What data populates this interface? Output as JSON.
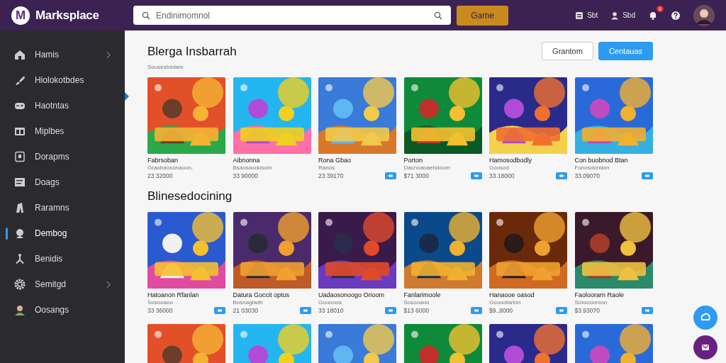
{
  "topbar": {
    "logo_letter": "M",
    "brand": "Marksplace",
    "search": {
      "placeholder": "Endinimomnol"
    },
    "search_button": "Game",
    "links": [
      {
        "label": "Sbt",
        "kind": "list"
      },
      {
        "label": "Sbd",
        "kind": "user"
      }
    ],
    "notifications": {
      "badge": "6"
    }
  },
  "sidebar": {
    "items": [
      {
        "label": "Hamis",
        "kind": "home",
        "expandable": true,
        "selected": false
      },
      {
        "label": "Hiolokotbdes",
        "kind": "brush",
        "expandable": false,
        "selected": false
      },
      {
        "label": "Haotntas",
        "kind": "gamepad",
        "expandable": false,
        "selected": false
      },
      {
        "label": "Miplbes",
        "kind": "card",
        "expandable": false,
        "selected": false
      },
      {
        "label": "Dorapms",
        "kind": "doc",
        "expandable": false,
        "selected": false
      },
      {
        "label": "Doags",
        "kind": "list",
        "expandable": false,
        "selected": false
      },
      {
        "label": "Raramns",
        "kind": "figure",
        "expandable": false,
        "selected": false
      },
      {
        "label": "Dembog",
        "kind": "bust",
        "expandable": false,
        "selected": true
      },
      {
        "label": "Benidis",
        "kind": "person",
        "expandable": false,
        "selected": false
      },
      {
        "label": "Semitgd",
        "kind": "gear",
        "expandable": true,
        "selected": false
      },
      {
        "label": "Oosangs",
        "kind": "avatar",
        "expandable": false,
        "selected": false
      }
    ]
  },
  "sections": [
    {
      "title": "Blerga Insbarrah",
      "subtitle": "Sousestoidam",
      "buttons": [
        {
          "label": "Grantom",
          "kind": "outline"
        },
        {
          "label": "Centauas",
          "kind": "primary"
        }
      ],
      "cards": [
        {
          "title": "Fabrsoban",
          "subtitle": "Graobaosonaoon,",
          "price": "23 32000",
          "cart_button": false
        },
        {
          "title": "Aibnonna",
          "subtitle": "Bsaosaodosom",
          "price": "33 90000",
          "cart_button": false
        },
        {
          "title": "Rona Gbao",
          "subtitle": "Ranos",
          "price": "23 39170",
          "cart_button": true
        },
        {
          "title": "Porton",
          "subtitle": "Dacnoaoaebdoom",
          "price": "$71 3000",
          "cart_button": true
        },
        {
          "title": "Hamosodbodly",
          "subtitle": "Goosod",
          "price": "33 18000",
          "cart_button": true
        },
        {
          "title": "Con buobnod Btan",
          "subtitle": "Fonosdondon",
          "price": "33.09070",
          "cart_button": true
        }
      ]
    },
    {
      "title": "Blinesedocining",
      "cards": [
        {
          "title": "Hatoanon Rfanlan",
          "subtitle": "Sosooaoo",
          "price": "33 36000",
          "cart_button": true
        },
        {
          "title": "Datura Goccit optus",
          "subtitle": "Bosnagladh",
          "price": "21 03030",
          "cart_button": true
        },
        {
          "title": "Uadaosonoogo Orioom",
          "subtitle": "Goooooa",
          "price": "33 18010",
          "cart_button": true
        },
        {
          "title": "Fanlarimoole",
          "subtitle": "Sosooaoo",
          "price": "$13 6000",
          "cart_button": true
        },
        {
          "title": "Hanaooe oasod",
          "subtitle": "Gooootarton",
          "price": "$9.,8000",
          "cart_button": true
        },
        {
          "title": "Faoloorarn Raole",
          "subtitle": "Sotooooroon",
          "price": "$3.93070",
          "cart_button": true
        }
      ]
    },
    {
      "cards": [
        {
          "kind": "picture"
        },
        {
          "kind": "picture"
        },
        {
          "kind": "picture"
        },
        {
          "kind": "picture"
        },
        {
          "kind": "picture"
        },
        {
          "kind": "picture"
        }
      ]
    }
  ]
}
